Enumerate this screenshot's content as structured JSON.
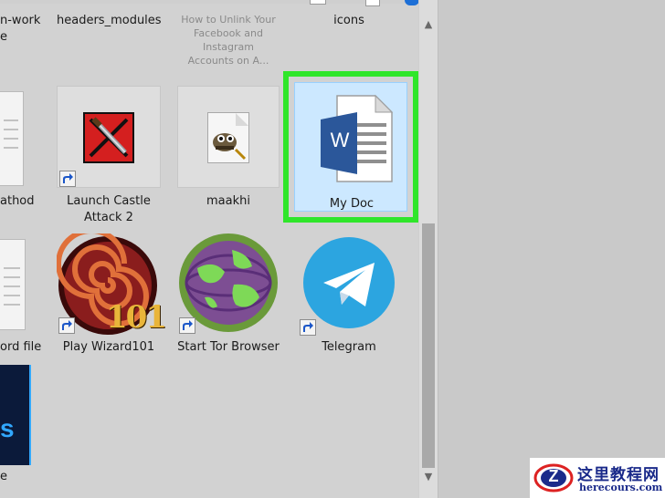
{
  "top_row": {
    "col1_label": "n-work",
    "col1_sublabel": "e",
    "col2_label": "headers_modules",
    "col3_label": "How to Unlink Your Facebook and Instagram Accounts on A...",
    "col4_label": "icons"
  },
  "row2": {
    "partial_label": "athod",
    "items": [
      {
        "label": "Launch Castle Attack 2",
        "icon": "castle-attack-icon",
        "shortcut": true
      },
      {
        "label": "maakhi",
        "icon": "gimp-file-icon",
        "shortcut": false
      },
      {
        "label": "My Doc",
        "icon": "word-document-icon",
        "shortcut": false,
        "selected": true
      }
    ]
  },
  "row3": {
    "partial_label": "ord file",
    "items": [
      {
        "label": "Play Wizard101",
        "icon": "wizard101-icon",
        "shortcut": true
      },
      {
        "label": "Start Tor Browser",
        "icon": "tor-browser-icon",
        "shortcut": true
      },
      {
        "label": "Telegram",
        "icon": "telegram-icon",
        "shortcut": true
      }
    ]
  },
  "row4": {
    "partial_label": "e",
    "partial_icon": "photoshop-file-icon",
    "partial_icon_text": "s"
  },
  "overlay_number": "101",
  "word_letter": "W",
  "watermark": {
    "title": "这里教程网",
    "url": "herecours.com",
    "logo_letter": "Z"
  },
  "colors": {
    "selection_border": "#2fe62a",
    "selection_fill": "#cce8ff",
    "word_blue": "#2b579a",
    "telegram_blue": "#2ca5e0"
  }
}
